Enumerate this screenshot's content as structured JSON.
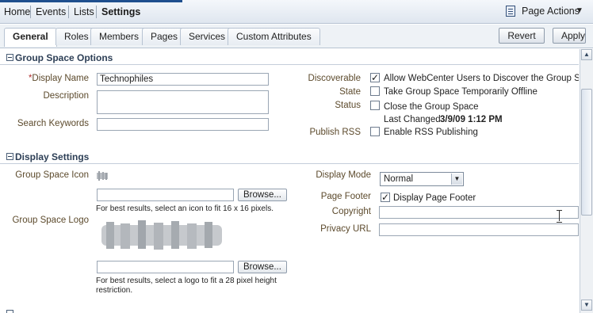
{
  "topnav": {
    "items": [
      {
        "label": "Home"
      },
      {
        "label": "Events"
      },
      {
        "label": "Lists"
      },
      {
        "label": "Settings"
      }
    ],
    "page_actions_label": "Page Actions"
  },
  "tabs": [
    {
      "label": "General",
      "active": true
    },
    {
      "label": "Roles"
    },
    {
      "label": "Members"
    },
    {
      "label": "Pages"
    },
    {
      "label": "Services"
    },
    {
      "label": "Custom Attributes"
    }
  ],
  "buttons": {
    "revert": "Revert",
    "apply": "Apply"
  },
  "group_space_options": {
    "title": "Group Space Options",
    "display_name_required": "*",
    "display_name_label": "Display Name",
    "display_name_value": "Technophiles",
    "description_label": "Description",
    "search_keywords_label": "Search Keywords",
    "discoverable_label": "Discoverable",
    "discoverable_option": "Allow WebCenter Users to Discover the Group Space",
    "discoverable_checked": true,
    "state_label": "State",
    "state_option": "Take Group Space Temporarily Offline",
    "state_checked": false,
    "status_label": "Status",
    "status_option": "Close the Group Space",
    "status_checked": false,
    "last_changed_label": "Last Changed",
    "last_changed_value": "3/9/09 1:12 PM",
    "publish_rss_label": "Publish RSS",
    "publish_rss_option": "Enable RSS Publishing",
    "publish_rss_checked": false
  },
  "display_settings": {
    "title": "Display Settings",
    "icon_label": "Group Space Icon",
    "browse_label": "Browse...",
    "icon_hint": "For best results, select an icon to fit 16 x 16 pixels.",
    "logo_label": "Group Space Logo",
    "logo_hint": "For best results, select a logo to fit a 28 pixel height restriction.",
    "display_mode_label": "Display Mode",
    "display_mode_value": "Normal",
    "page_footer_label": "Page Footer",
    "page_footer_option": "Display Page Footer",
    "page_footer_checked": true,
    "copyright_label": "Copyright",
    "privacy_url_label": "Privacy URL"
  },
  "colors": {
    "label": "#5c4a2c",
    "section_title": "#2d3f56",
    "nav_strip": "#1f4f8e"
  },
  "icons": [
    "page-actions-icon",
    "collapse-icon",
    "checkbox-icon",
    "scroll-up-icon",
    "scroll-down-icon",
    "dropdown-arrow-icon"
  ]
}
